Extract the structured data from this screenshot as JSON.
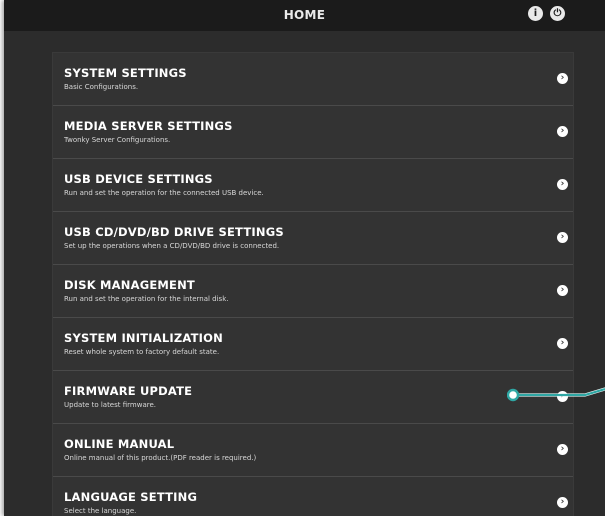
{
  "header": {
    "title": "HOME",
    "info_icon": "i",
    "power_icon": "⏻"
  },
  "menu": {
    "items": [
      {
        "title": "SYSTEM SETTINGS",
        "description": "Basic Configurations."
      },
      {
        "title": "MEDIA SERVER SETTINGS",
        "description": "Twonky Server Configurations."
      },
      {
        "title": "USB DEVICE SETTINGS",
        "description": "Run and set the operation for the connected USB device."
      },
      {
        "title": "USB CD/DVD/BD DRIVE SETTINGS",
        "description": "Set up the operations when a CD/DVD/BD drive is connected."
      },
      {
        "title": "DISK MANAGEMENT",
        "description": "Run and set the operation for the internal disk."
      },
      {
        "title": "SYSTEM INITIALIZATION",
        "description": "Reset whole system to factory default state."
      },
      {
        "title": "FIRMWARE UPDATE",
        "description": "Update to latest firmware."
      },
      {
        "title": "ONLINE MANUAL",
        "description": "Online manual of this product.(PDF reader is required.)"
      },
      {
        "title": "LANGUAGE SETTING",
        "description": "Select the language."
      }
    ],
    "chevron": "›"
  },
  "colors": {
    "background": "#2c2c2c",
    "topbar": "#1b1b1b",
    "panel": "#333333",
    "callout": "#2fa7a4"
  }
}
